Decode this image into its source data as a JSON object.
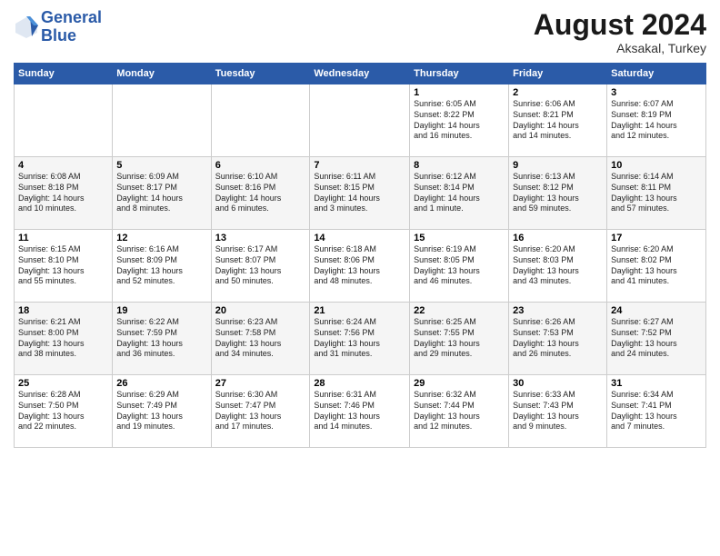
{
  "header": {
    "logo_line1": "General",
    "logo_line2": "Blue",
    "month_title": "August 2024",
    "location": "Aksakal, Turkey"
  },
  "weekdays": [
    "Sunday",
    "Monday",
    "Tuesday",
    "Wednesday",
    "Thursday",
    "Friday",
    "Saturday"
  ],
  "weeks": [
    [
      {
        "day": "",
        "info": ""
      },
      {
        "day": "",
        "info": ""
      },
      {
        "day": "",
        "info": ""
      },
      {
        "day": "",
        "info": ""
      },
      {
        "day": "1",
        "info": "Sunrise: 6:05 AM\nSunset: 8:22 PM\nDaylight: 14 hours\nand 16 minutes."
      },
      {
        "day": "2",
        "info": "Sunrise: 6:06 AM\nSunset: 8:21 PM\nDaylight: 14 hours\nand 14 minutes."
      },
      {
        "day": "3",
        "info": "Sunrise: 6:07 AM\nSunset: 8:19 PM\nDaylight: 14 hours\nand 12 minutes."
      }
    ],
    [
      {
        "day": "4",
        "info": "Sunrise: 6:08 AM\nSunset: 8:18 PM\nDaylight: 14 hours\nand 10 minutes."
      },
      {
        "day": "5",
        "info": "Sunrise: 6:09 AM\nSunset: 8:17 PM\nDaylight: 14 hours\nand 8 minutes."
      },
      {
        "day": "6",
        "info": "Sunrise: 6:10 AM\nSunset: 8:16 PM\nDaylight: 14 hours\nand 6 minutes."
      },
      {
        "day": "7",
        "info": "Sunrise: 6:11 AM\nSunset: 8:15 PM\nDaylight: 14 hours\nand 3 minutes."
      },
      {
        "day": "8",
        "info": "Sunrise: 6:12 AM\nSunset: 8:14 PM\nDaylight: 14 hours\nand 1 minute."
      },
      {
        "day": "9",
        "info": "Sunrise: 6:13 AM\nSunset: 8:12 PM\nDaylight: 13 hours\nand 59 minutes."
      },
      {
        "day": "10",
        "info": "Sunrise: 6:14 AM\nSunset: 8:11 PM\nDaylight: 13 hours\nand 57 minutes."
      }
    ],
    [
      {
        "day": "11",
        "info": "Sunrise: 6:15 AM\nSunset: 8:10 PM\nDaylight: 13 hours\nand 55 minutes."
      },
      {
        "day": "12",
        "info": "Sunrise: 6:16 AM\nSunset: 8:09 PM\nDaylight: 13 hours\nand 52 minutes."
      },
      {
        "day": "13",
        "info": "Sunrise: 6:17 AM\nSunset: 8:07 PM\nDaylight: 13 hours\nand 50 minutes."
      },
      {
        "day": "14",
        "info": "Sunrise: 6:18 AM\nSunset: 8:06 PM\nDaylight: 13 hours\nand 48 minutes."
      },
      {
        "day": "15",
        "info": "Sunrise: 6:19 AM\nSunset: 8:05 PM\nDaylight: 13 hours\nand 46 minutes."
      },
      {
        "day": "16",
        "info": "Sunrise: 6:20 AM\nSunset: 8:03 PM\nDaylight: 13 hours\nand 43 minutes."
      },
      {
        "day": "17",
        "info": "Sunrise: 6:20 AM\nSunset: 8:02 PM\nDaylight: 13 hours\nand 41 minutes."
      }
    ],
    [
      {
        "day": "18",
        "info": "Sunrise: 6:21 AM\nSunset: 8:00 PM\nDaylight: 13 hours\nand 38 minutes."
      },
      {
        "day": "19",
        "info": "Sunrise: 6:22 AM\nSunset: 7:59 PM\nDaylight: 13 hours\nand 36 minutes."
      },
      {
        "day": "20",
        "info": "Sunrise: 6:23 AM\nSunset: 7:58 PM\nDaylight: 13 hours\nand 34 minutes."
      },
      {
        "day": "21",
        "info": "Sunrise: 6:24 AM\nSunset: 7:56 PM\nDaylight: 13 hours\nand 31 minutes."
      },
      {
        "day": "22",
        "info": "Sunrise: 6:25 AM\nSunset: 7:55 PM\nDaylight: 13 hours\nand 29 minutes."
      },
      {
        "day": "23",
        "info": "Sunrise: 6:26 AM\nSunset: 7:53 PM\nDaylight: 13 hours\nand 26 minutes."
      },
      {
        "day": "24",
        "info": "Sunrise: 6:27 AM\nSunset: 7:52 PM\nDaylight: 13 hours\nand 24 minutes."
      }
    ],
    [
      {
        "day": "25",
        "info": "Sunrise: 6:28 AM\nSunset: 7:50 PM\nDaylight: 13 hours\nand 22 minutes."
      },
      {
        "day": "26",
        "info": "Sunrise: 6:29 AM\nSunset: 7:49 PM\nDaylight: 13 hours\nand 19 minutes."
      },
      {
        "day": "27",
        "info": "Sunrise: 6:30 AM\nSunset: 7:47 PM\nDaylight: 13 hours\nand 17 minutes."
      },
      {
        "day": "28",
        "info": "Sunrise: 6:31 AM\nSunset: 7:46 PM\nDaylight: 13 hours\nand 14 minutes."
      },
      {
        "day": "29",
        "info": "Sunrise: 6:32 AM\nSunset: 7:44 PM\nDaylight: 13 hours\nand 12 minutes."
      },
      {
        "day": "30",
        "info": "Sunrise: 6:33 AM\nSunset: 7:43 PM\nDaylight: 13 hours\nand 9 minutes."
      },
      {
        "day": "31",
        "info": "Sunrise: 6:34 AM\nSunset: 7:41 PM\nDaylight: 13 hours\nand 7 minutes."
      }
    ]
  ]
}
